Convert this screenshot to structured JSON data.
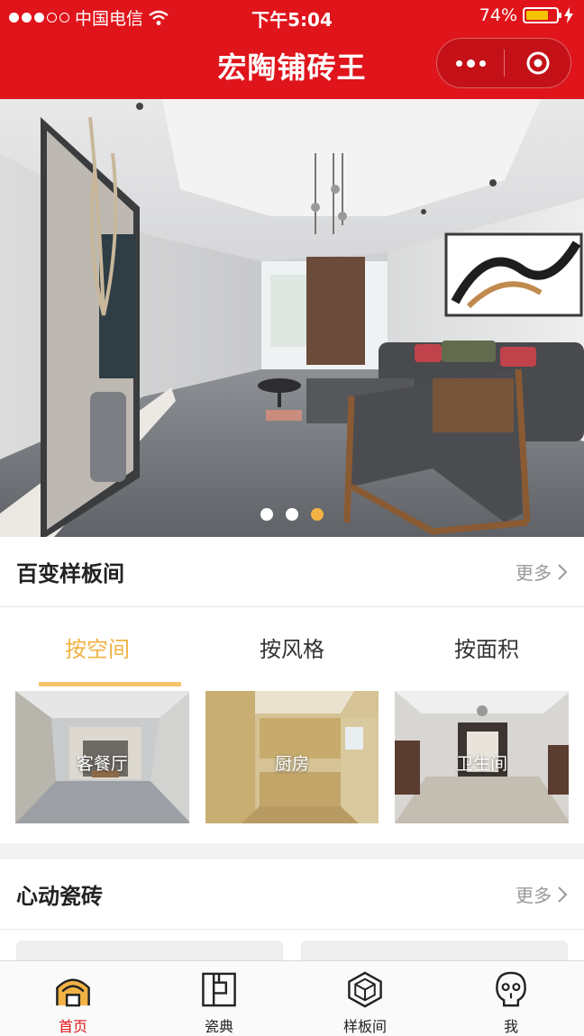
{
  "status_bar": {
    "carrier": "中国电信",
    "time": "下午5:04",
    "battery": "74%",
    "battery_level": 0.74
  },
  "nav": {
    "title": "宏陶铺砖王"
  },
  "banner": {
    "slide_count": 3,
    "active_slide": 3
  },
  "sample_rooms": {
    "title": "百变样板间",
    "more_label": "更多",
    "tabs": [
      {
        "label": "按空间",
        "active": true
      },
      {
        "label": "按风格",
        "active": false
      },
      {
        "label": "按面积",
        "active": false
      }
    ],
    "rooms": [
      {
        "label": "客餐厅"
      },
      {
        "label": "厨房"
      },
      {
        "label": "卫生间"
      }
    ]
  },
  "tiles": {
    "title": "心动瓷砖",
    "more_label": "更多"
  },
  "tabbar": [
    {
      "label": "首页",
      "icon": "home-icon",
      "active": true
    },
    {
      "label": "瓷典",
      "icon": "catalog-icon",
      "active": false
    },
    {
      "label": "样板间",
      "icon": "showroom-icon",
      "active": false
    },
    {
      "label": "我",
      "icon": "profile-icon",
      "active": false
    }
  ],
  "colors": {
    "brand_red": "#e0141b",
    "accent_gold": "#f2b244"
  }
}
